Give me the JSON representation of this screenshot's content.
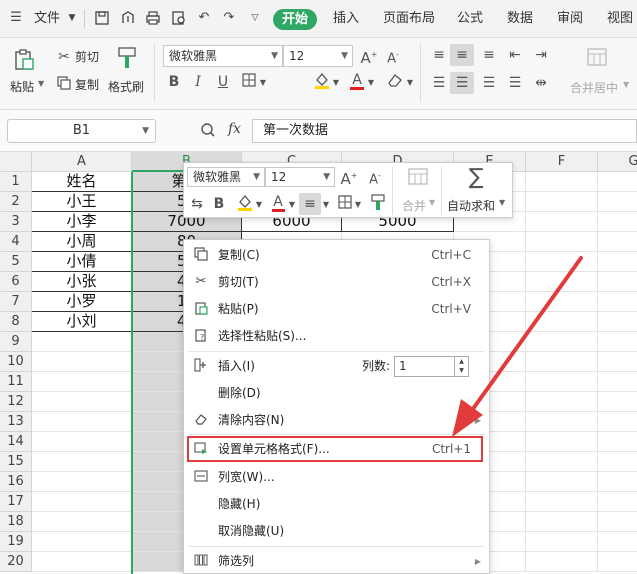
{
  "menubar": {
    "file_label": "文件",
    "tabs": [
      "开始",
      "插入",
      "页面布局",
      "公式",
      "数据",
      "审阅",
      "视图"
    ]
  },
  "ribbon": {
    "paste": "粘贴",
    "cut": "剪切",
    "copy": "复制",
    "format_painter": "格式刷",
    "font_name": "微软雅黑",
    "font_size": "12",
    "merge_center": "合并居中"
  },
  "formula_bar": {
    "name_box": "B1",
    "fx": "fx",
    "content": "第一次数据"
  },
  "sheet": {
    "columns": [
      "A",
      "B",
      "C",
      "D",
      "E",
      "F",
      "G"
    ],
    "rows": [
      "1",
      "2",
      "3",
      "4",
      "5",
      "6",
      "7",
      "8",
      "9",
      "10",
      "11",
      "12",
      "13",
      "14",
      "15",
      "16",
      "17",
      "18",
      "19",
      "20"
    ],
    "colA": [
      "姓名",
      "小王",
      "小李",
      "小周",
      "小倩",
      "小张",
      "小罗",
      "小刘"
    ],
    "colB": [
      "第一",
      "50",
      "7000",
      "80",
      "50",
      "45",
      "10",
      "40"
    ],
    "c3": "6000",
    "d3": "5000"
  },
  "minibar": {
    "font_name": "微软雅黑",
    "font_size": "12",
    "merge": "合并",
    "autosum": "自动求和"
  },
  "context_menu": {
    "copy": "复制(C)",
    "copy_sc": "Ctrl+C",
    "cut": "剪切(T)",
    "cut_sc": "Ctrl+X",
    "paste": "粘贴(P)",
    "paste_sc": "Ctrl+V",
    "paste_special": "选择性粘贴(S)...",
    "insert": "插入(I)",
    "col_count_label": "列数:",
    "col_count_value": "1",
    "delete": "删除(D)",
    "clear": "清除内容(N)",
    "format_cells": "设置单元格格式(F)...",
    "format_cells_sc": "Ctrl+1",
    "col_width": "列宽(W)...",
    "hide": "隐藏(H)",
    "unhide": "取消隐藏(U)",
    "filter_col": "筛选列"
  },
  "colors": {
    "accent": "#2fa663",
    "highlight": "#e23b3b"
  }
}
